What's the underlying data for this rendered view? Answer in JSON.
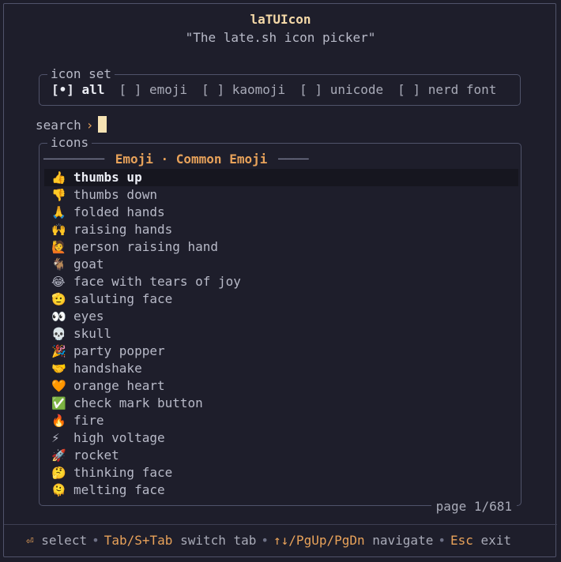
{
  "header": {
    "title": "laTUIcon",
    "subtitle": "\"The late.sh icon picker\""
  },
  "icon_set": {
    "legend": "icon set",
    "options": [
      {
        "mark": "[•]",
        "label": "all",
        "selected": true
      },
      {
        "mark": "[ ]",
        "label": "emoji",
        "selected": false
      },
      {
        "mark": "[ ]",
        "label": "kaomoji",
        "selected": false
      },
      {
        "mark": "[ ]",
        "label": "unicode",
        "selected": false
      },
      {
        "mark": "[ ]",
        "label": "nerd font",
        "selected": false
      }
    ]
  },
  "search": {
    "label": "search",
    "arrow": "›",
    "value": ""
  },
  "icons": {
    "legend": "icons",
    "group_left": "────────",
    "group_title": "Emoji · Common Emoji",
    "group_right": "────",
    "items": [
      {
        "icon": "👍",
        "name": "thumbs up",
        "selected": true
      },
      {
        "icon": "👎",
        "name": "thumbs down"
      },
      {
        "icon": "🙏",
        "name": "folded hands"
      },
      {
        "icon": "🙌",
        "name": "raising hands"
      },
      {
        "icon": "🙋",
        "name": "person raising hand"
      },
      {
        "icon": "🐐",
        "name": "goat"
      },
      {
        "icon": "😂",
        "name": "face with tears of joy"
      },
      {
        "icon": "🫡",
        "name": "saluting face"
      },
      {
        "icon": "👀",
        "name": "eyes"
      },
      {
        "icon": "💀",
        "name": "skull"
      },
      {
        "icon": "🎉",
        "name": "party popper"
      },
      {
        "icon": "🤝",
        "name": "handshake"
      },
      {
        "icon": "🧡",
        "name": "orange heart"
      },
      {
        "icon": "✅",
        "name": "check mark button"
      },
      {
        "icon": "🔥",
        "name": "fire"
      },
      {
        "icon": "⚡",
        "name": "high voltage"
      },
      {
        "icon": "🚀",
        "name": "rocket"
      },
      {
        "icon": "🤔",
        "name": "thinking face"
      },
      {
        "icon": "🫠",
        "name": "melting face"
      }
    ],
    "page": "page 1/681"
  },
  "footer": {
    "select_key": "⏎",
    "select_label": "select",
    "tab_key": "Tab/S+Tab",
    "tab_label": "switch tab",
    "nav_key": "↑↓/PgUp/PgDn",
    "nav_label": "navigate",
    "exit_key": "Esc",
    "exit_label": "exit",
    "separator": "•"
  }
}
